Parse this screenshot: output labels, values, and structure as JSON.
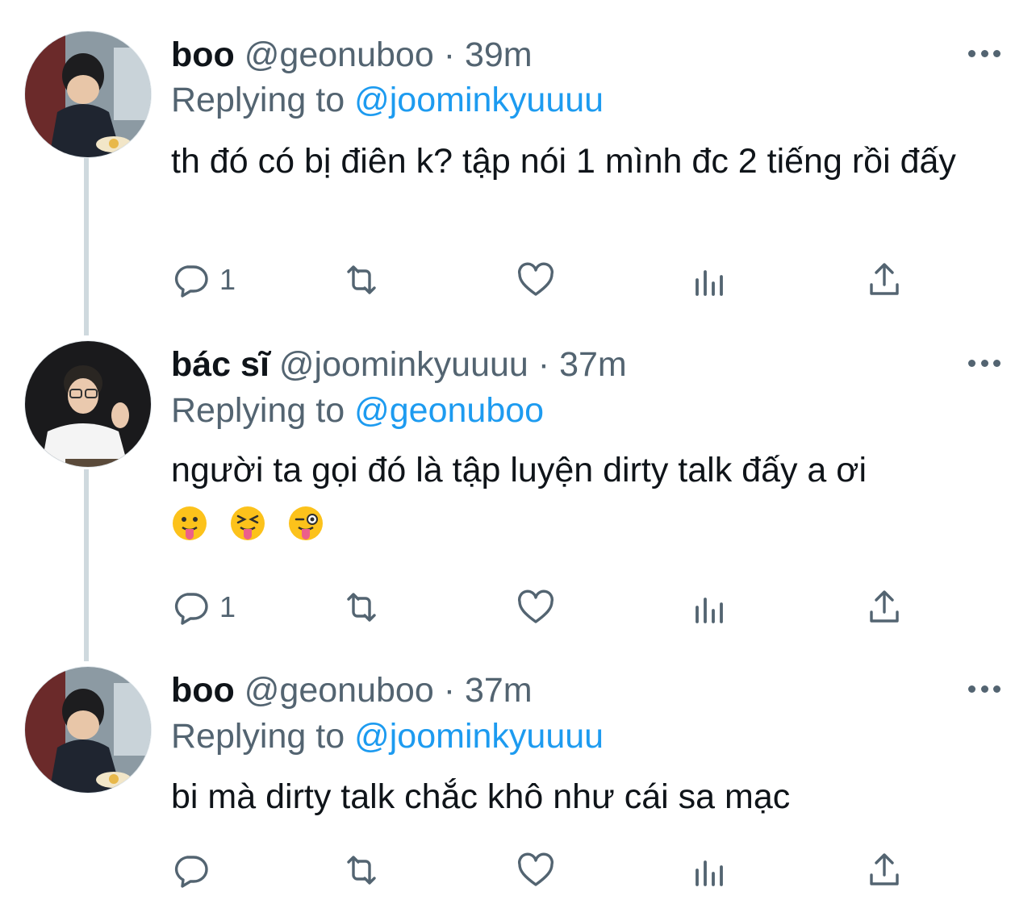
{
  "tweets": [
    {
      "name": "boo",
      "handle": "@geonuboo",
      "dot": "·",
      "time": "39m",
      "replying_label": "Replying to",
      "replying_to": "@joominkyuuuu",
      "text": "th đó có bị điên k? tập nói 1 mình đc 2 tiếng rồi đấy",
      "reply_count": "1"
    },
    {
      "name": "bác sĩ",
      "handle": "@joominkyuuuu",
      "dot": "·",
      "time": "37m",
      "replying_label": "Replying to",
      "replying_to": "@geonuboo",
      "text": "người ta gọi đó là tập luyện dirty talk đấy a ơi",
      "emojis": [
        "face-with-tongue",
        "squinting-face",
        "winking-face-with-tongue"
      ],
      "reply_count": "1"
    },
    {
      "name": "boo",
      "handle": "@geonuboo",
      "dot": "·",
      "time": "37m",
      "replying_label": "Replying to",
      "replying_to": "@joominkyuuuu",
      "text": "bi mà dirty talk chắc khô như cái sa mạc",
      "reply_count": ""
    }
  ],
  "icons": [
    "reply-icon",
    "retweet-icon",
    "like-icon",
    "analytics-icon",
    "share-icon",
    "more-icon"
  ],
  "colors": {
    "accent": "#1d9bf0",
    "secondary": "#536471",
    "text": "#0f1419",
    "thread_line": "#cfd9de"
  }
}
